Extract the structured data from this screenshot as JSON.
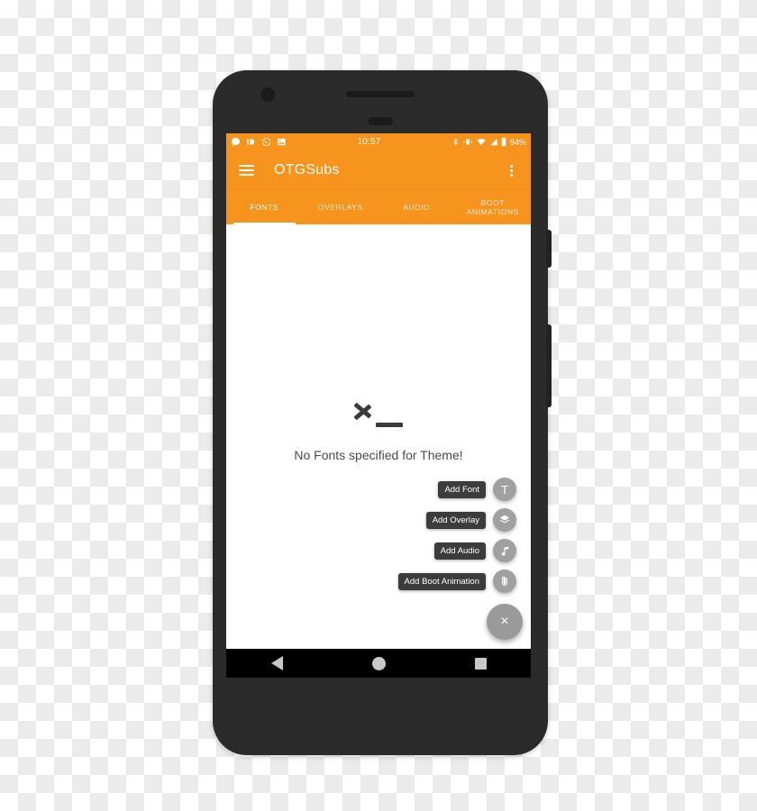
{
  "device": {
    "name": "android-phone-mockup",
    "body_color": "#2b2b2b"
  },
  "status_bar": {
    "time": "10:57",
    "battery_percent": "94%",
    "left_icons": [
      "chat-bubble-icon",
      "dual-sim-icon",
      "whatsapp-icon",
      "photo-icon"
    ],
    "right_icons": [
      "bluetooth-icon",
      "vibrate-icon",
      "wifi-icon",
      "signal-icon",
      "battery-icon"
    ],
    "background_color": "#f7941e"
  },
  "toolbar": {
    "title": "OTGSubs",
    "menu_icon": "hamburger-icon",
    "overflow_icon": "overflow-menu-icon",
    "background_color": "#f7941e",
    "text_color": "#ffffff"
  },
  "tabs": {
    "active_index": 0,
    "items": [
      {
        "label": "FONTS"
      },
      {
        "label": "OVERLAYS"
      },
      {
        "label": "AUDIO"
      },
      {
        "label": "BOOT ANIMATIONS"
      }
    ]
  },
  "content": {
    "empty_state": {
      "icon": "terminal-prompt-icon",
      "message": "No Fonts specified for Theme!"
    }
  },
  "fab_menu": {
    "expanded": true,
    "main_fab": {
      "icon": "close-icon",
      "glyph": "×",
      "color": "#9a9a9a"
    },
    "actions": [
      {
        "label": "Add Font",
        "icon": "font-t-icon",
        "glyph": "T"
      },
      {
        "label": "Add Overlay",
        "icon": "layers-icon",
        "glyph": "◆"
      },
      {
        "label": "Add Audio",
        "icon": "music-note-icon",
        "glyph": "♪"
      },
      {
        "label": "Add Boot Animation",
        "icon": "paperclip-icon",
        "glyph": "📎"
      }
    ]
  },
  "nav_bar": {
    "back": "back-triangle-icon",
    "home": "home-circle-icon",
    "recents": "recents-square-icon",
    "background_color": "#000000"
  }
}
